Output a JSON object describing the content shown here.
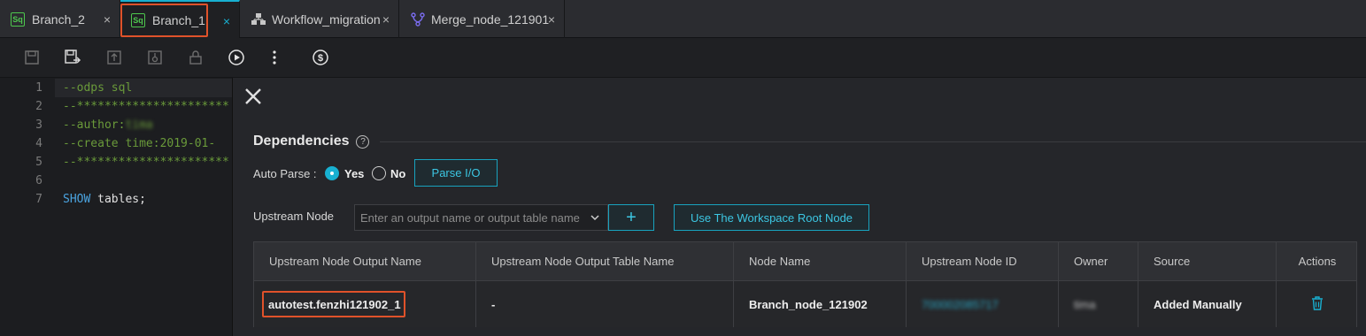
{
  "tabs": [
    {
      "label": "Branch_2",
      "icon": "sql-file-icon",
      "icon_text": "Sq"
    },
    {
      "label": "Branch_1",
      "icon": "sql-file-icon",
      "icon_text": "Sq",
      "active": true
    },
    {
      "label": "Workflow_migration",
      "icon": "workflow-icon"
    },
    {
      "label": "Merge_node_121901",
      "icon": "merge-icon"
    }
  ],
  "tab_close_glyph": "×",
  "toolbar": {
    "icons": [
      "save-icon",
      "save-as-icon",
      "submit-icon",
      "steal-lock-icon",
      "lock-icon",
      "run-icon",
      "more-icon",
      "cost-estimate-icon"
    ]
  },
  "editor": {
    "lines": [
      {
        "num": "1",
        "text": "--odps sql",
        "style": "comment"
      },
      {
        "num": "2",
        "text": "--**********************",
        "style": "comment"
      },
      {
        "num": "3",
        "text": "--author:",
        "suffix": "tima",
        "style": "comment"
      },
      {
        "num": "4",
        "text": "--create time:2019-01-",
        "style": "comment"
      },
      {
        "num": "5",
        "text": "--**********************",
        "style": "comment"
      },
      {
        "num": "6",
        "text": "",
        "style": "comment"
      },
      {
        "num": "7",
        "kw": "SHOW",
        "text": " tables;",
        "style": "code"
      }
    ]
  },
  "dependencies": {
    "title": "Dependencies",
    "help_glyph": "?",
    "auto_parse_label": "Auto Parse :",
    "yes_label": "Yes",
    "no_label": "No",
    "auto_parse_selected": "Yes",
    "parse_io_button": "Parse I/O",
    "upstream_label": "Upstream Node",
    "upstream_placeholder": "Enter an output name or output table name",
    "add_button": "+",
    "root_node_button": "Use The Workspace Root Node",
    "table": {
      "headers": [
        "Upstream Node Output Name",
        "Upstream Node Output Table Name",
        "Node Name",
        "Upstream Node ID",
        "Owner",
        "Source",
        "Actions"
      ],
      "rows": [
        {
          "output_name": "autotest.fenzhi121902_1",
          "output_table": "-",
          "node_name": "Branch_node_121902",
          "node_id": "700002085717",
          "owner": "tima",
          "source": "Added Manually",
          "action_icon": "delete-icon"
        }
      ]
    }
  },
  "colors": {
    "accent": "#18b0d1",
    "highlight_box": "#e0522a",
    "sql_icon": "#4ec74e",
    "workflow_icon": "#c7c7c7",
    "merge_icon": "#7b6df0"
  }
}
